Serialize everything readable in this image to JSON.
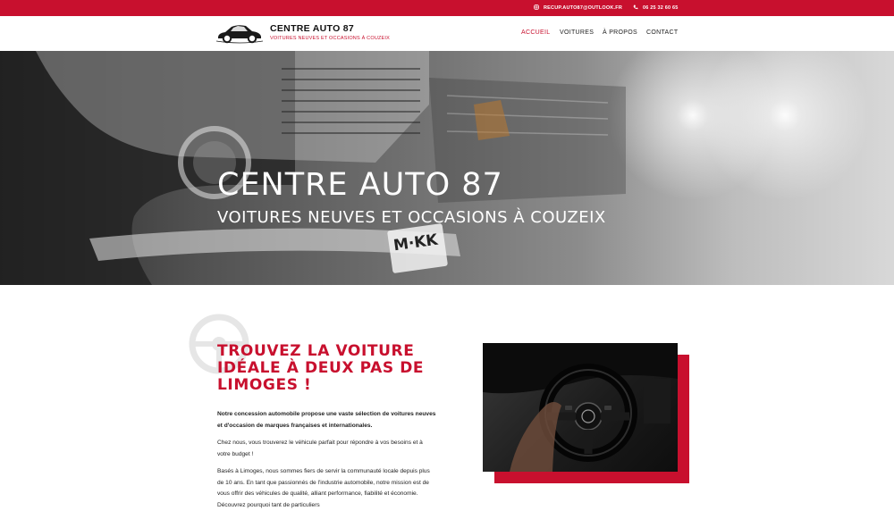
{
  "topbar": {
    "email": "RECUP.AUTO87@OUTLOOK.FR",
    "email_icon": "instagram-icon",
    "phone": "06 25 32 60 65",
    "phone_icon": "phone-icon"
  },
  "header": {
    "logo_icon": "car-logo-icon",
    "title": "CENTRE AUTO 87",
    "subtitle": "VOITURES NEUVES ET OCCASIONS À COUZEIX",
    "nav": [
      "ACCUEIL",
      "VOITURES",
      "À PROPOS",
      "CONTACT"
    ],
    "active": "ACCUEIL"
  },
  "hero": {
    "title": "CENTRE AUTO 87",
    "subtitle": "VOITURES NEUVES ET OCCASIONS À COUZEIX",
    "plate": "M·KK"
  },
  "intro": {
    "headline": "TROUVEZ LA VOITURE IDÉALE À DEUX PAS DE LIMOGES !",
    "p1": "Notre concession automobile propose une vaste sélection de voitures neuves et d'occasion de marques françaises et internationales.",
    "p2": "Chez nous, vous trouverez le véhicule parfait pour répondre à vos besoins et à votre budget !",
    "p3": "Basés à Limoges, nous sommes fiers de servir la communauté locale depuis plus de 10 ans. En tant que passionnés de l'industrie automobile, notre mission est de vous offrir des véhicules de qualité, alliant performance, fiabilité et économie. Découvrez pourquoi tant de particuliers"
  },
  "colors": {
    "accent": "#c8102e",
    "text": "#222222"
  }
}
